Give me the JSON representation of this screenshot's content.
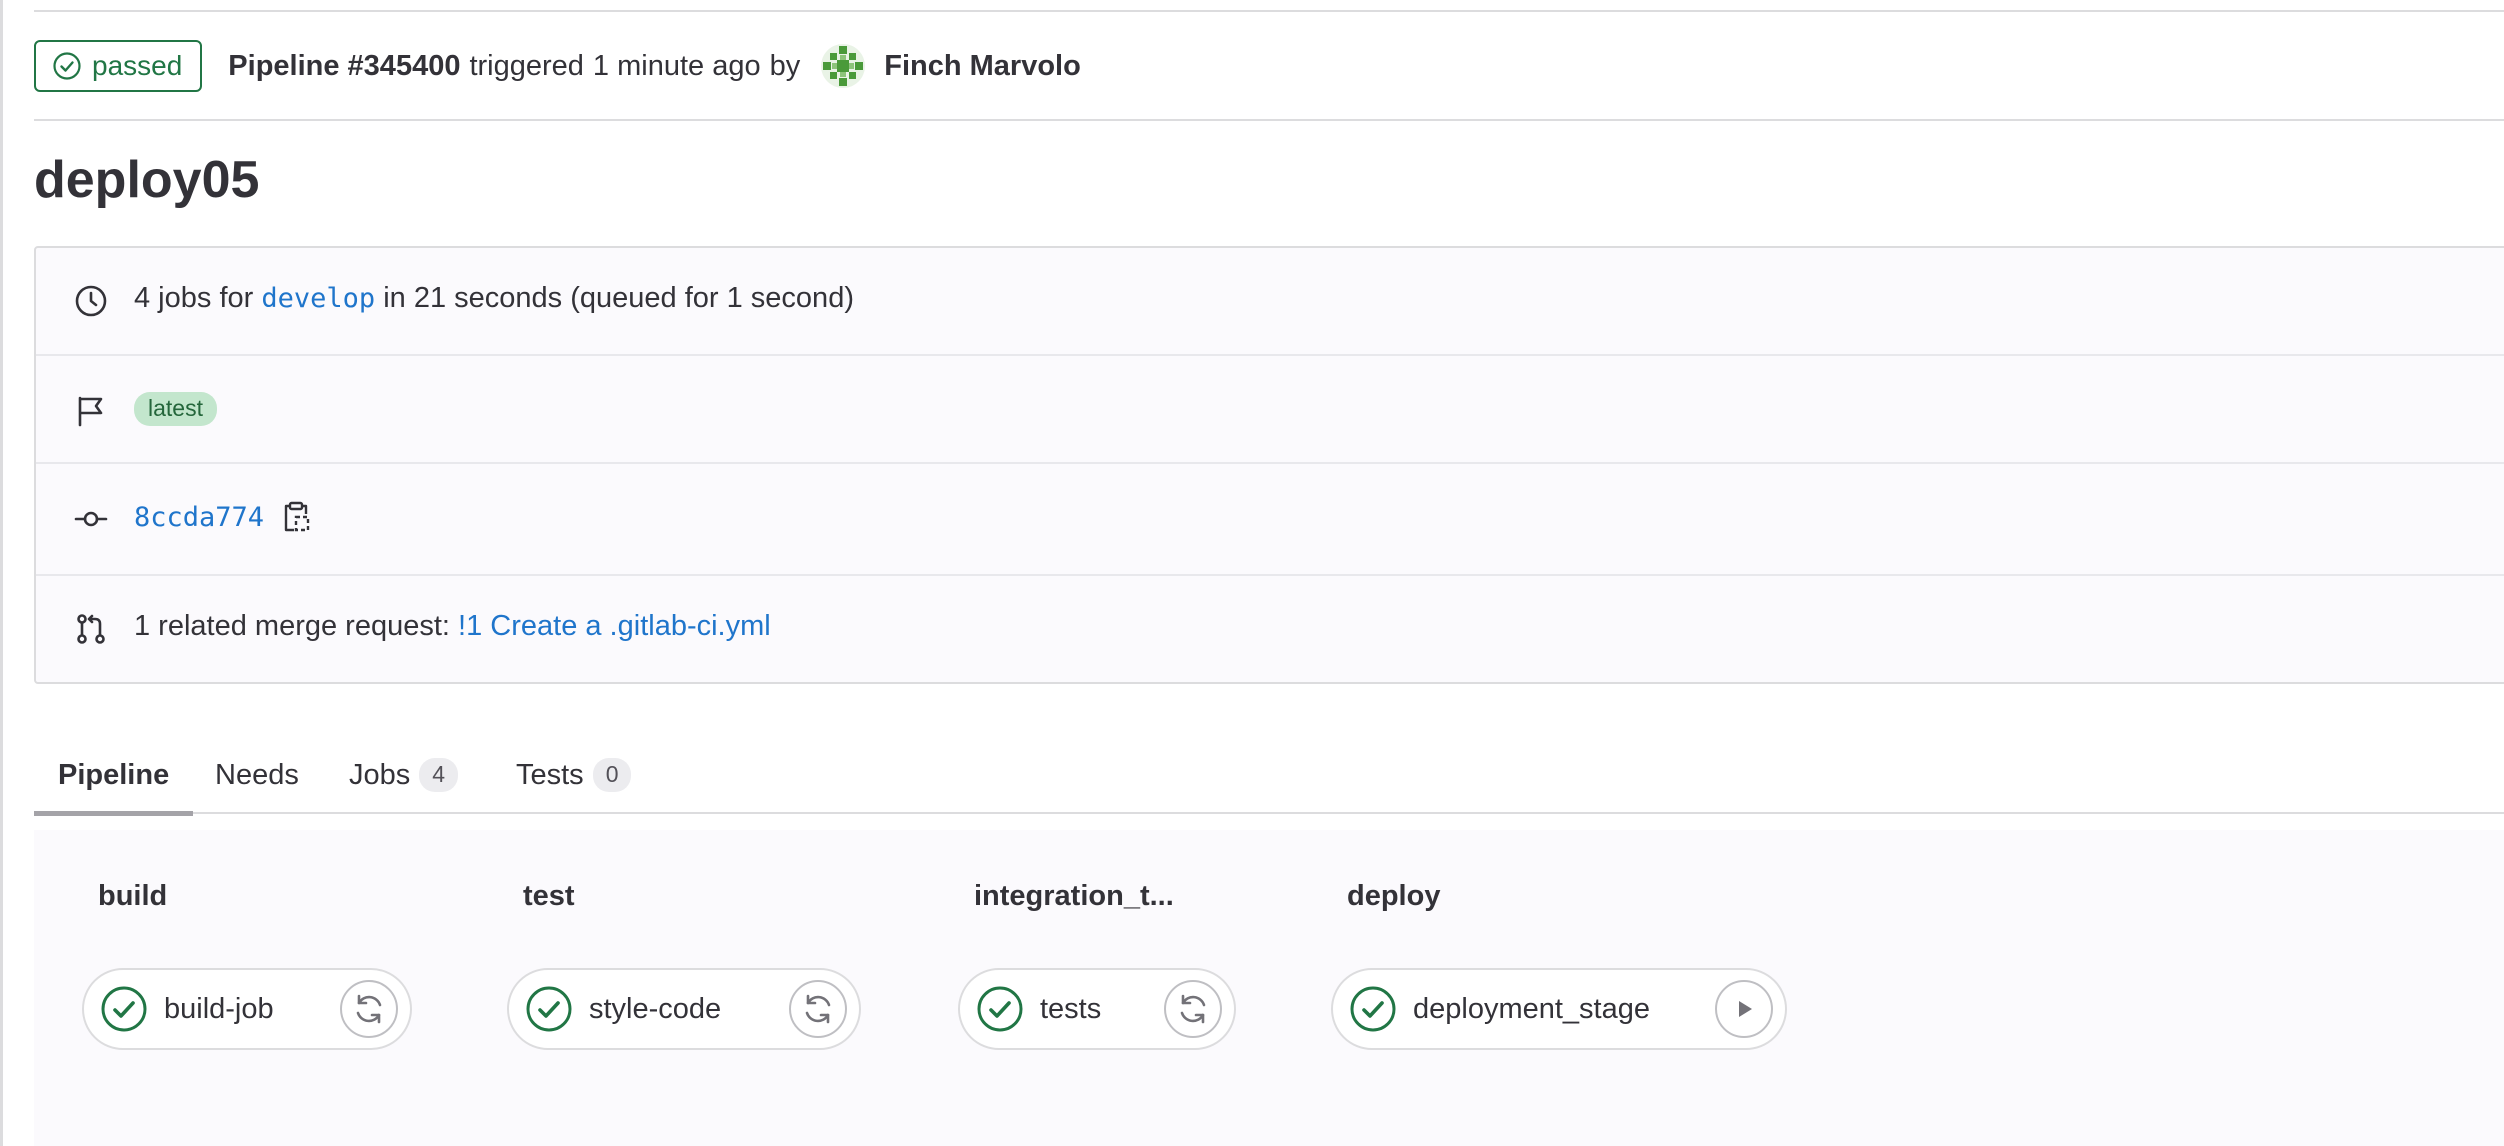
{
  "header": {
    "status_label": "passed",
    "pipeline_label": "Pipeline #345400",
    "triggered_text": "triggered",
    "time_text": "1 minute ago",
    "by_text": "by",
    "username": "Finch Marvolo"
  },
  "title": "deploy05",
  "info": {
    "jobs_prefix": "4 jobs for",
    "branch": "develop",
    "jobs_suffix": "in 21 seconds (queued for 1 second)",
    "tag": "latest",
    "commit_sha": "8ccda774",
    "mr_prefix": "1 related merge request:",
    "mr_link": "!1 Create a .gitlab-ci.yml"
  },
  "tabs": [
    {
      "label": "Pipeline",
      "active": true
    },
    {
      "label": "Needs"
    },
    {
      "label": "Jobs",
      "count": "4"
    },
    {
      "label": "Tests",
      "count": "0"
    }
  ],
  "stages": [
    {
      "title": "build",
      "job": "build-job",
      "status": "success",
      "action": "retry-icon"
    },
    {
      "title": "test",
      "job": "style-code",
      "status": "success",
      "action": "retry-icon"
    },
    {
      "title": "integration_t...",
      "job": "tests",
      "status": "success",
      "action": "retry-icon"
    },
    {
      "title": "deploy",
      "job": "deployment_stage",
      "status": "success",
      "action": "play-icon"
    }
  ],
  "colors": {
    "success": "#217645",
    "link": "#1f75cb",
    "tag_bg": "#c3e6cd"
  }
}
